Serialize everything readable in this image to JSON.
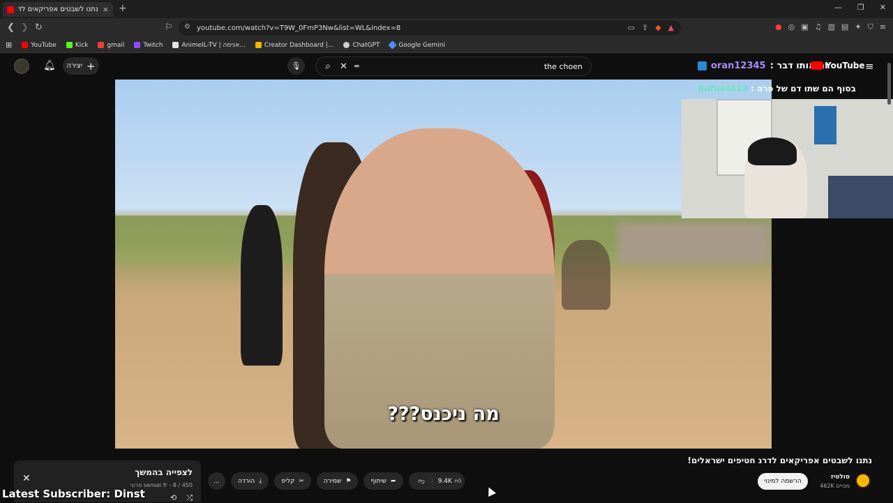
{
  "browser": {
    "tab_title": "נתנו לשבטים אפריקאים לדרג",
    "tab_close": "×",
    "new_tab": "+",
    "url": "youtube.com/watch?v=T9W_0FmP3Nw&list=WL&index=8",
    "bookmarks": [
      {
        "label": "YouTube",
        "color": "#ff0000"
      },
      {
        "label": "Kick",
        "color": "#53fc18"
      },
      {
        "label": "gmail",
        "color": "#ea4335"
      },
      {
        "label": "Twitch",
        "color": "#9146ff"
      },
      {
        "label": "AnimeIL-TV | אנימה...",
        "color": "#e5e5e5"
      },
      {
        "label": "Creator Dashboard |...",
        "color": "#ffb400"
      },
      {
        "label": "ChatGPT",
        "color": "#cccccc"
      },
      {
        "label": "Google Gemini",
        "color": "#4f8df5"
      }
    ]
  },
  "youtube": {
    "create_label": "יצירה",
    "search_query": "the choen",
    "logo_text": "YouTube",
    "stream_overlay": {
      "chat_line_1_user": "oran12345",
      "chat_line_1_text": "זה אותו דבר :",
      "chat_line_2_user": "Rufus4813",
      "chat_line_2_text": "בסוף הם שתו דם של פרה :",
      "latest_subscriber": "Latest Subscriber: Dinst"
    },
    "video": {
      "subtitle": "מה ניכנס???",
      "title": "נתנו לשבטים אפריקאים לדרג חטיפים ישראלים!",
      "channel_name": "סולטיז",
      "channel_subs": "462K מנויים",
      "subscribe_label": "הרשמה למינוי",
      "like_count": "9.4K",
      "share_label": "שיתוף",
      "save_label": "שמירה",
      "clip_label": "קליפ",
      "download_label": "הורדה",
      "more_label": "..."
    },
    "playlist": {
      "title": "לצפייה בהמשך",
      "meta": "450 / 8 - sensei fr פרטי"
    }
  }
}
